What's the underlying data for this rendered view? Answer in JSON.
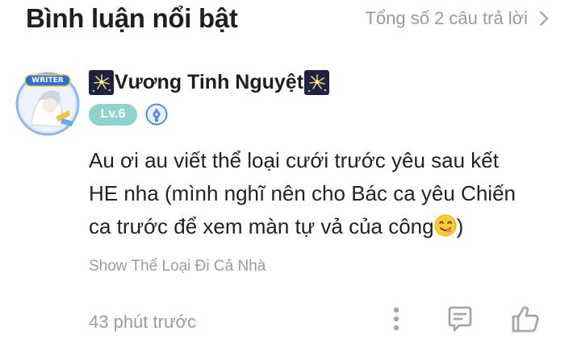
{
  "header": {
    "title": "Bình luận nổi bật",
    "total_link": "Tổng số 2 câu trả lời"
  },
  "comment": {
    "avatar_label": "WRITER",
    "username": "Vương Tinh Nguyệt",
    "level": "Lv.6",
    "text_lines": [
      "Au ơi au viết thể loại cưới trước yêu sau kết",
      "HE nha (mình nghĩ nên cho Bác ca yêu Chiến",
      "ca trước để xem màn tự vả của công",
      ")"
    ],
    "tag": "Show Thể Loại Đi Cả Nhà",
    "time": "43 phút trước"
  },
  "colors": {
    "level_badge": "#8fd3ce",
    "secondary_text": "#9b9b9b",
    "primary_text": "#222222",
    "icon_gray": "#a7a7a7"
  },
  "icons": [
    "chevron-right-icon",
    "firework-icon",
    "pen-nib-icon",
    "yum-emoji-icon",
    "more-vertical-icon",
    "comment-icon",
    "thumbs-up-icon"
  ]
}
